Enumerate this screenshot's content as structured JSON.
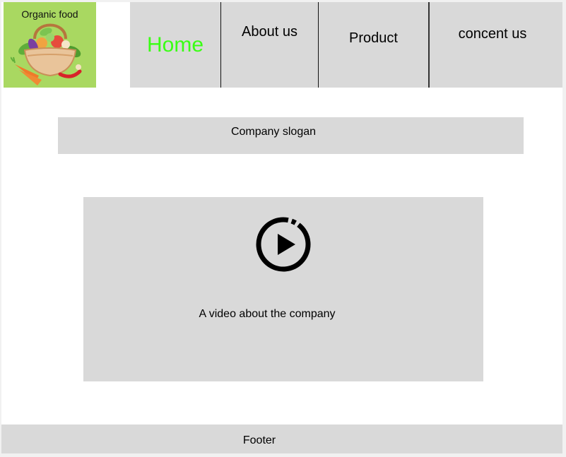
{
  "logo": {
    "title": "Organic food",
    "image": "vegetable-basket-icon"
  },
  "nav": {
    "items": [
      {
        "label": "Home",
        "active": true
      },
      {
        "label": "About us",
        "active": false
      },
      {
        "label": "Product",
        "active": false
      },
      {
        "label": "concent us",
        "active": false
      }
    ],
    "active_color": "#39ff14"
  },
  "slogan": {
    "text": "Company slogan"
  },
  "video": {
    "caption": "A video about the company",
    "icon": "play-circle-icon"
  },
  "footer": {
    "text": "Footer"
  },
  "colors": {
    "panel": "#d9d9d9",
    "logo_bg": "#a9d861"
  }
}
